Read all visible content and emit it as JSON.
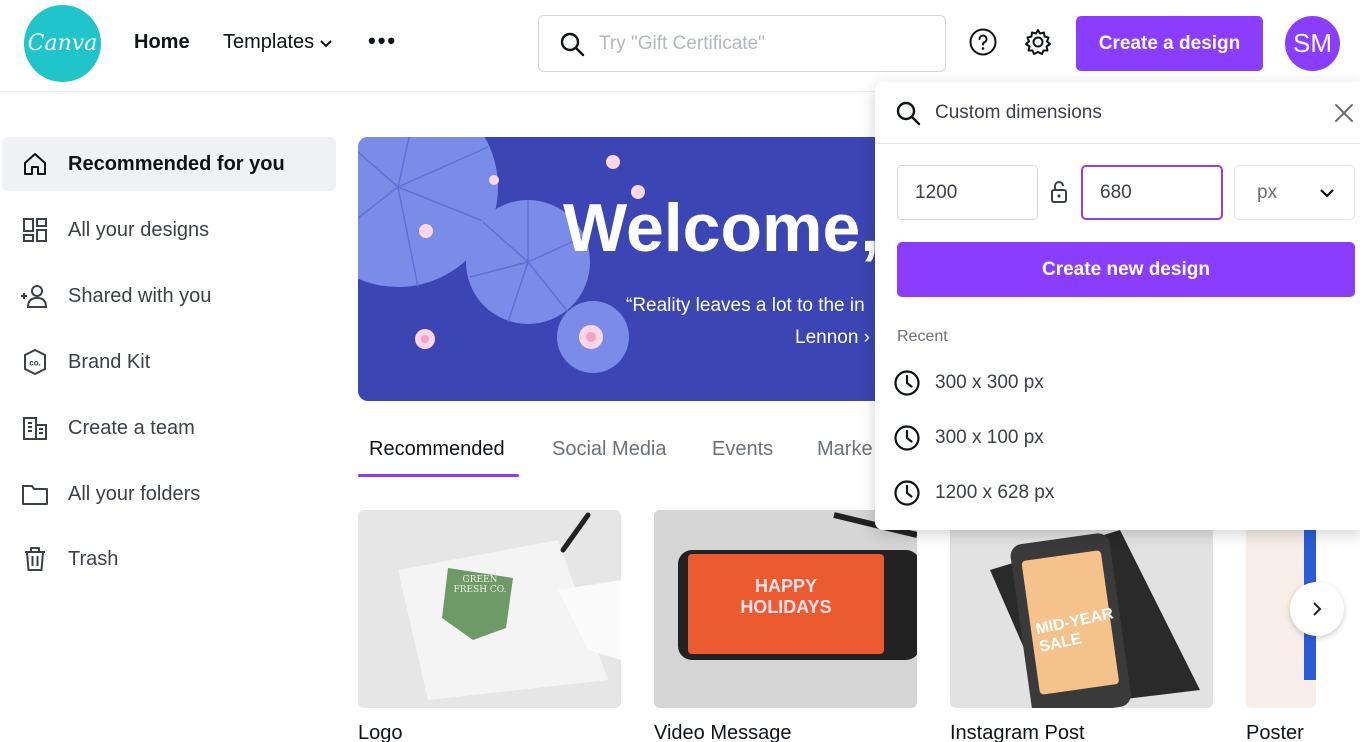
{
  "header": {
    "logo_text": "Canva",
    "nav_home": "Home",
    "nav_templates": "Templates",
    "nav_more": "•••",
    "search_placeholder": "Try \"Gift Certificate\"",
    "create_button": "Create a design",
    "avatar_initials": "SM"
  },
  "sidebar": {
    "items": [
      {
        "label": "Recommended for you",
        "icon": "home-icon",
        "active": true
      },
      {
        "label": "All your designs",
        "icon": "grid-icon",
        "active": false
      },
      {
        "label": "Shared with you",
        "icon": "shared-users-icon",
        "active": false
      },
      {
        "label": "Brand Kit",
        "icon": "brand-kit-icon",
        "active": false
      },
      {
        "label": "Create a team",
        "icon": "building-icon",
        "active": false
      },
      {
        "label": "All your folders",
        "icon": "folder-icon",
        "active": false
      },
      {
        "label": "Trash",
        "icon": "trash-icon",
        "active": false
      }
    ]
  },
  "banner": {
    "title": "Welcome,",
    "quote": "“Reality leaves a lot to the in",
    "author": "Lennon ›"
  },
  "tabs": [
    "Recommended",
    "Social Media",
    "Events",
    "Marke"
  ],
  "cards": [
    {
      "label": "Logo",
      "art_text": "GREEN FRESH CO."
    },
    {
      "label": "Video Message",
      "art_text": "HAPPY HOLIDAYS"
    },
    {
      "label": "Instagram Post",
      "art_text": "MID-YEAR SALE"
    },
    {
      "label": "Poster",
      "art_text": ""
    }
  ],
  "panel": {
    "search_text": "Custom dimensions",
    "width_value": "1200",
    "height_value": "680",
    "unit": "px",
    "create_button": "Create new design",
    "recent_label": "Recent",
    "recent": [
      "300 x 300 px",
      "300 x 100 px",
      "1200 x 628 px"
    ]
  },
  "colors": {
    "accent": "#8b3dff",
    "logo": "#20c4cb",
    "banner": "#3b46b4"
  }
}
